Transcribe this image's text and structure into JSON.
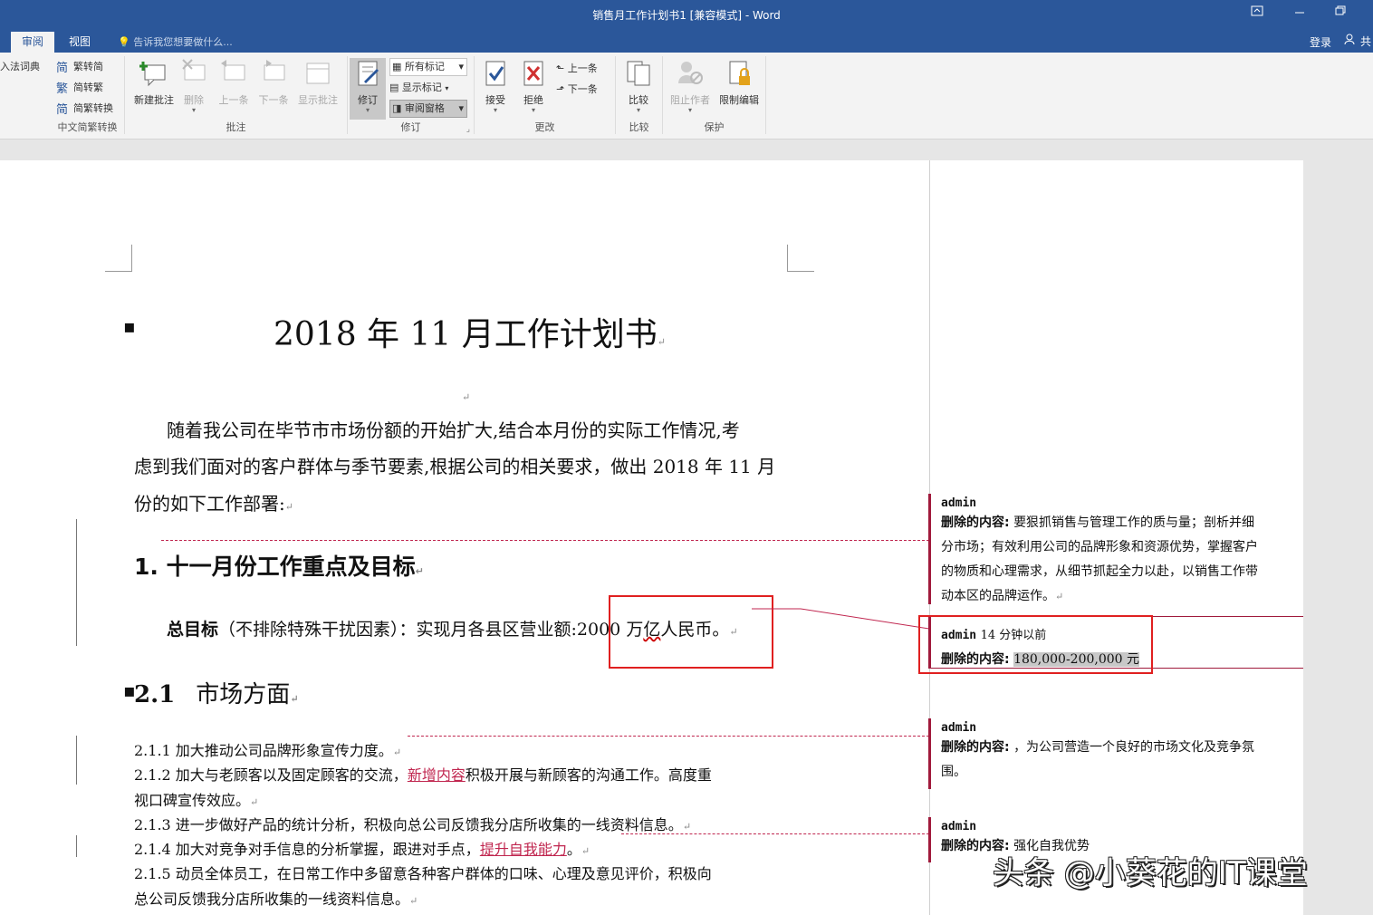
{
  "window": {
    "title": "销售月工作计划书1 [兼容模式] - Word",
    "ribbon_display_icon": "ribbon-display-icon",
    "minimize_icon": "minimize-icon",
    "restore_icon": "restore-icon"
  },
  "tabs": {
    "review": "审阅",
    "view": "视图",
    "tell_me": "告诉我您想要做什么...",
    "login": "登录",
    "share": "共"
  },
  "ribbon": {
    "dictionary": "入法词典",
    "chinese_conversion": {
      "to_traditional": "繁转简",
      "to_simplified": "简转繁",
      "convert": "简繁转换",
      "group_label": "中文简繁转换"
    },
    "comments": {
      "new": "新建批注",
      "delete": "删除",
      "previous": "上一条",
      "next": "下一条",
      "show": "显示批注",
      "group_label": "批注"
    },
    "tracking": {
      "track": "修订",
      "all_markup": "所有标记",
      "show_markup": "显示标记",
      "review_pane": "审阅窗格",
      "group_label": "修订"
    },
    "changes": {
      "accept": "接受",
      "reject": "拒绝",
      "previous": "上一条",
      "next": "下一条",
      "group_label": "更改"
    },
    "compare": {
      "compare": "比较",
      "group_label": "比较"
    },
    "protect": {
      "block_authors": "阻止作者",
      "restrict_editing": "限制编辑",
      "group_label": "保护"
    }
  },
  "document": {
    "title": "2018 年 11 月工作计划书",
    "intro_line1": "随着我公司在毕节市市场份额的开始扩大,结合本月份的实际工作情况,考",
    "intro_line2": "虑到我们面对的客户群体与季节要素,根据公司的相关要求，做出 2018 年 11 月",
    "intro_line3": "份的如下工作部署:",
    "heading1": "1. 十一月份工作重点及目标",
    "goal_label": "总目标",
    "goal_text": "（不排除特殊干扰因素）：实现月各县区营业额:",
    "goal_amount_pre": "2000 万",
    "goal_amount_wavy": "亿",
    "goal_amount_post": "人民币。",
    "heading2_num": "2.1",
    "heading2_text": "市场方面",
    "item1": "2.1.1  加大推动公司品牌形象宣传力度。",
    "item2_pre": "2.1.2  加大与老顾客以及固定顾客的交流，",
    "item2_ins": "新增内容",
    "item2_post": "积极开展与新顾客的沟通工作。高度重",
    "item2_line2": "视口碑宣传效应。",
    "item3": "2.1.3  进一步做好产品的统计分析，积极向总公司反馈我分店所收集的一线资料信息。",
    "item4_pre": "2.1.4  加大对竞争对手信息的分析掌握，跟进对手点，",
    "item4_ins": "提升自我能力",
    "item4_post": "。",
    "item5_line1": "2.1.5  动员全体员工，在日常工作中多留意各种客户群体的口味、心理及意见评价，积极向",
    "item5_line2": "总公司反馈我分店所收集的一线资料信息。"
  },
  "balloons": [
    {
      "author": "admin",
      "label": "删除的内容:",
      "text_line1": "要狠抓销售与管理工作的质与量；剖析并细",
      "text_line2": "分市场；有效利用公司的品牌形象和资源优势，掌握客户",
      "text_line3": "的物质和心理需求，从细节抓起全力以赴，以销售工作带",
      "text_line4": "动本区的品牌运作。"
    },
    {
      "author": "admin",
      "time": "14 分钟以前",
      "label": "删除的内容:",
      "text": "180,000-200,000 元"
    },
    {
      "author": "admin",
      "label": "删除的内容:",
      "text_line1": "，为公司营造一个良好的市场文化及竞争氛",
      "text_line2": "围。"
    },
    {
      "author": "admin",
      "label": "删除的内容:",
      "text": "强化自我优势"
    }
  ],
  "watermark": "头条 @小葵花的IT课堂",
  "colors": {
    "title_bar": "#2b579a",
    "insertion": "#c0264f",
    "highlight_box": "#e02020"
  }
}
